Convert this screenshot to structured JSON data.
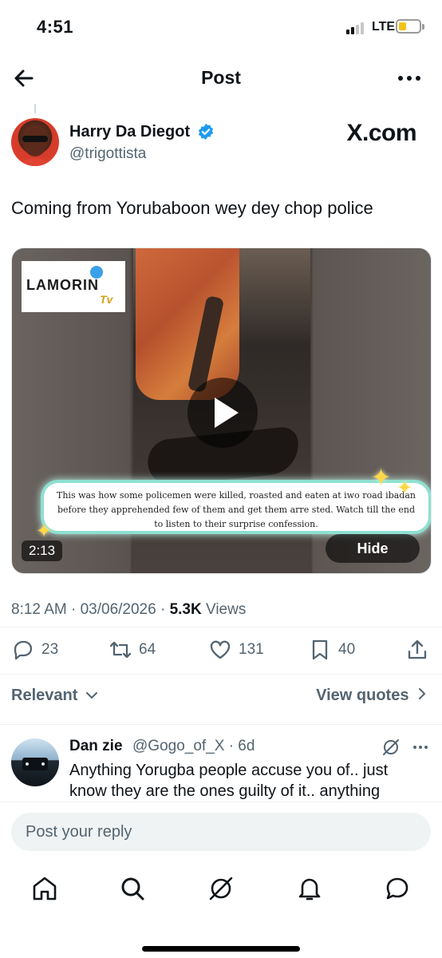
{
  "status_bar": {
    "time": "4:51",
    "network": "LTE",
    "battery_icon": "battery-low-icon"
  },
  "header": {
    "title": "Post",
    "back_icon": "back-arrow-icon",
    "more_icon": "more-icon"
  },
  "post": {
    "author_name": "Harry Da Diegot",
    "handle": "@trigottista",
    "watermark": "X.com",
    "text": "Coming from Yorubaboon wey dey chop police",
    "media": {
      "logo_text": "LAMORIN",
      "logo_sub": "Tv",
      "caption": "This was how some policemen were killed, roasted and eaten at iwo road ibadan before they apprehended few of them and get them arre sted. Watch till the end to listen to their surprise confession.",
      "duration": "2:13",
      "hide_label": "Hide"
    },
    "timestamp": "8:12 AM · 03/06/2026 ·",
    "views_count": "5.3K",
    "views_label": "Views"
  },
  "actions": {
    "replies": "23",
    "reposts": "64",
    "likes": "131",
    "bookmarks": "40"
  },
  "filters": {
    "sort_label": "Relevant",
    "quotes_label": "View quotes"
  },
  "reply": {
    "name": "Dan zie",
    "handle": "@Gogo_of_X · 6d",
    "text": "Anything Yorugba people accuse you of.. just know they are the ones guilty of it.. anything"
  },
  "composer": {
    "placeholder": "Post your reply"
  },
  "colors": {
    "verified": "#1d9bf0",
    "secondary_text": "#536471",
    "caption_border": "#8ee0d0",
    "battery": "#f2c318"
  }
}
